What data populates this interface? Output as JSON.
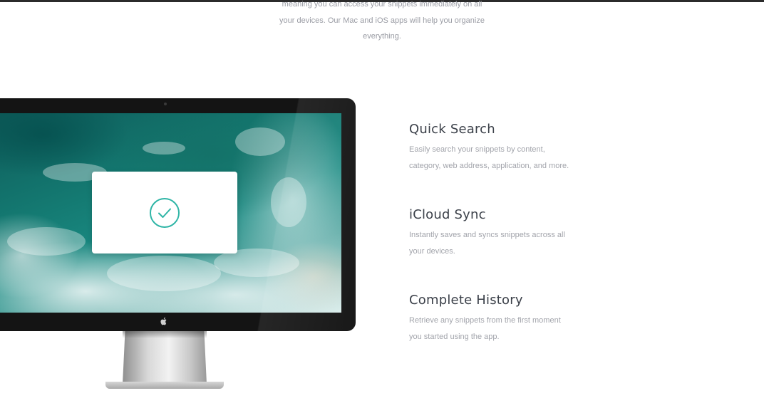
{
  "intro": {
    "lines": [
      "meaning you can access your snippets immediately on all",
      "your devices. Our Mac and iOS apps will help you organize",
      "everything."
    ]
  },
  "monitor": {
    "check_icon": "check-circle-icon",
    "logo_icon": "apple-icon"
  },
  "features": [
    {
      "title": "Quick Search",
      "desc_lines": [
        "Easily search your snippets by content,",
        "category, web address, application, and more."
      ]
    },
    {
      "title": "iCloud Sync",
      "desc_lines": [
        "Instantly saves and syncs snippets across all",
        "your devices."
      ]
    },
    {
      "title": "Complete History",
      "desc_lines": [
        "Retrieve any snippets from the first moment",
        "you started using the app."
      ]
    }
  ],
  "colors": {
    "accent": "#2fb5a6",
    "title_text": "#3b4049",
    "body_text": "#a2a4ab",
    "monitor_bezel": "#141414"
  }
}
